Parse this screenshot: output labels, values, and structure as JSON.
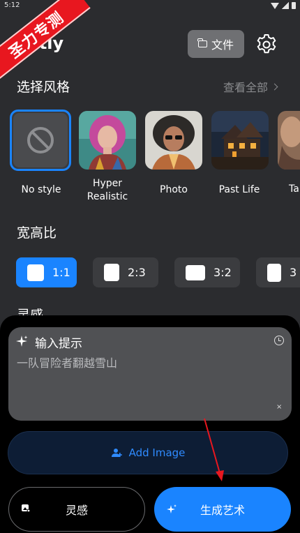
{
  "status_bar": {
    "time": "5:12"
  },
  "watermark": {
    "text": "圣力专测"
  },
  "header": {
    "app_title": "rtly",
    "file_button_label": "文件"
  },
  "styles_section": {
    "title": "选择风格",
    "view_all_label": "查看全部",
    "items": [
      {
        "label": "No style",
        "selected": true
      },
      {
        "label": "Hyper\nRealistic"
      },
      {
        "label": "Photo"
      },
      {
        "label": "Past Life"
      },
      {
        "label": "Ta"
      }
    ]
  },
  "aspect_section": {
    "title": "宽高比",
    "options": [
      {
        "label": "1:1",
        "selected": true
      },
      {
        "label": "2:3"
      },
      {
        "label": "3:2"
      },
      {
        "label": "3"
      }
    ]
  },
  "inspiration_section": {
    "title": "灵感"
  },
  "prompt": {
    "title": "输入提示",
    "text": "一队冒险者翻越雪山",
    "clear_symbol": "×"
  },
  "add_image": {
    "label": "Add Image"
  },
  "bottom_buttons": {
    "inspire_label": "灵感",
    "generate_label": "生成艺术"
  },
  "colors": {
    "accent": "#1a84ff",
    "background": "#2b2c2f",
    "panel": "#000000",
    "watermark": "#e8171f",
    "arrow": "#e8171f"
  }
}
